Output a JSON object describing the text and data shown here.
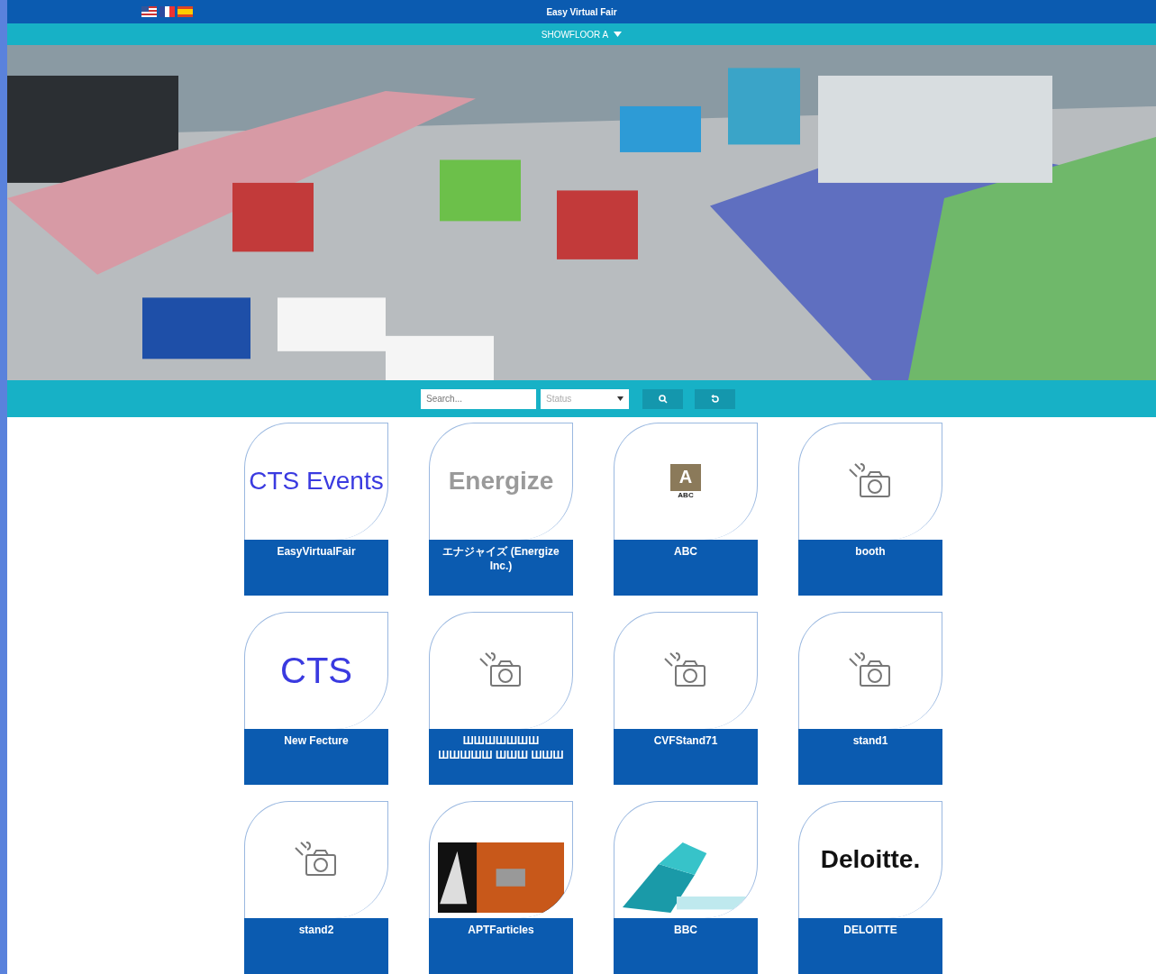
{
  "header": {
    "languages": [
      {
        "kind": "us"
      },
      {
        "kind": "fr"
      },
      {
        "kind": "es"
      }
    ],
    "title": "Easy Virtual Fair"
  },
  "floor_menu": {
    "label": "SHOWFLOOR A",
    "expanded": false
  },
  "filters": {
    "search": {
      "placeholder": "Search..."
    },
    "status": {
      "placeholder": "Status"
    }
  },
  "booths": [
    {
      "name": "EasyVirtualFair",
      "image": {
        "kind": "logo",
        "text": "CTS Events",
        "color": "#3a3ae0"
      }
    },
    {
      "name": "エナジャイズ (Energize Inc.)",
      "image": {
        "kind": "logo",
        "text": "Energize",
        "color": "#9a9a9a"
      }
    },
    {
      "name": "ABC",
      "image": {
        "kind": "badge",
        "text": "A",
        "caption": "ABC"
      }
    },
    {
      "name": "booth",
      "image": {
        "kind": "camera"
      }
    },
    {
      "name": "New Fecture",
      "image": {
        "kind": "logo",
        "text": "CTS",
        "color": "#3a3ae0"
      }
    },
    {
      "name": "ШШШШШШШ ШШШШШ ШШШ ШШШ",
      "image": {
        "kind": "camera"
      }
    },
    {
      "name": "CVFStand71",
      "image": {
        "kind": "camera"
      }
    },
    {
      "name": "stand1",
      "image": {
        "kind": "camera"
      }
    },
    {
      "name": "stand2",
      "image": {
        "kind": "camera"
      }
    },
    {
      "name": "APTFarticles"
    },
    {
      "name": "BBC"
    },
    {
      "name": "DELOITTE",
      "image": {
        "kind": "logo",
        "text": "Deloitte.",
        "color": "#111111"
      }
    }
  ]
}
